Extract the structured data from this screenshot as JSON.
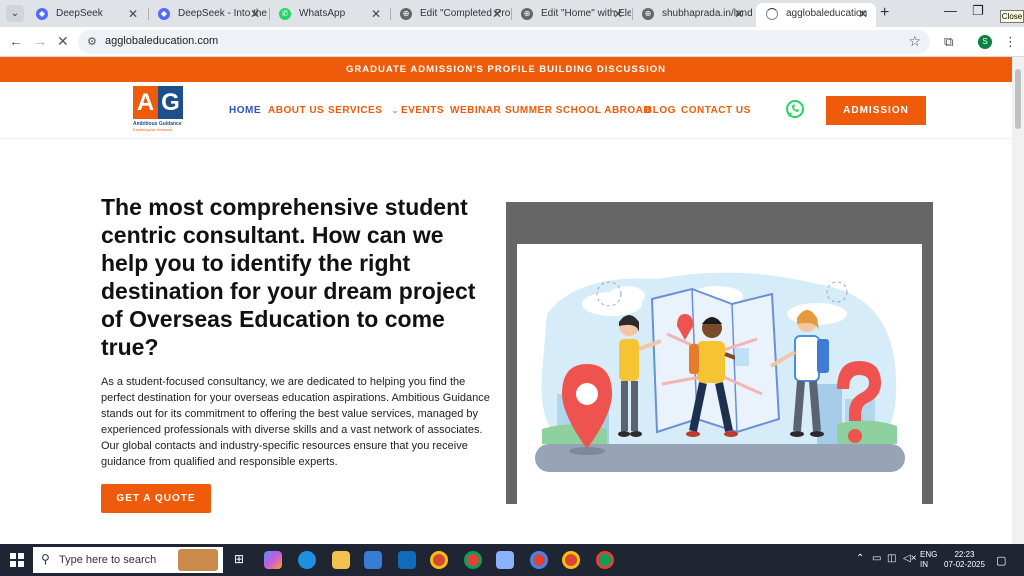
{
  "browser": {
    "tabs": [
      {
        "title": "DeepSeek",
        "icon": "deepseek-icon",
        "color": "#4d6bfe"
      },
      {
        "title": "DeepSeek - Into the",
        "icon": "deepseek-icon",
        "color": "#4d6bfe"
      },
      {
        "title": "WhatsApp",
        "icon": "whatsapp-icon",
        "color": "#25d366"
      },
      {
        "title": "Edit \"Completed Proj",
        "icon": "globe-icon",
        "color": "#666666"
      },
      {
        "title": "Edit \"Home\" with Ele",
        "icon": "globe-icon",
        "color": "#666666"
      },
      {
        "title": "shubhaprada.in/land",
        "icon": "globe-icon",
        "color": "#666666"
      },
      {
        "title": "agglobaleducation",
        "icon": "loading-icon",
        "color": "#666666",
        "active": true
      }
    ],
    "close_tooltip": "Close",
    "url": "agglobaleducation.com",
    "profile_initial": "S"
  },
  "site": {
    "announcement": "GRADUATE ADMISSION'S PROFILE BUILDING DISCUSSION",
    "logo": {
      "letter_a": "A",
      "letter_g": "G",
      "name": "Ambitious Guidance",
      "tagline": "Expand your Horizons"
    },
    "nav": [
      {
        "label": "HOME",
        "active": true
      },
      {
        "label": "ABOUT US"
      },
      {
        "label": "SERVICES",
        "caret": "⌄"
      },
      {
        "label": "EVENTS"
      },
      {
        "label": "WEBINAR"
      },
      {
        "label": "SUMMER SCHOOL ABROAD"
      },
      {
        "label": "BLOG"
      },
      {
        "label": "CONTACT US"
      }
    ],
    "admission_button": "ADMISSION",
    "hero": {
      "title": "The most comprehensive student centric consultant. How can we help you to identify the right destination for your dream project of Overseas Education to come true?",
      "description": "As a student-focused consultancy, we are dedicated to helping you find the perfect destination for your overseas education aspirations. Ambitious Guidance stands out for its commitment to offering the best value services, managed by experienced professionals with diverse skills and a vast network of associates. Our global contacts and industry-specific resources ensure that you receive guidance from qualified and responsible experts.",
      "cta": "GET A QUOTE"
    },
    "colors": {
      "brand_orange": "#ee5b0b",
      "brand_blue": "#1d4f8a",
      "nav_active": "#3152b8"
    }
  },
  "taskbar": {
    "search_placeholder": "Type here to search",
    "lang_line1": "ENG",
    "lang_line2": "IN",
    "time": "22:23",
    "date": "07-02-2025"
  }
}
